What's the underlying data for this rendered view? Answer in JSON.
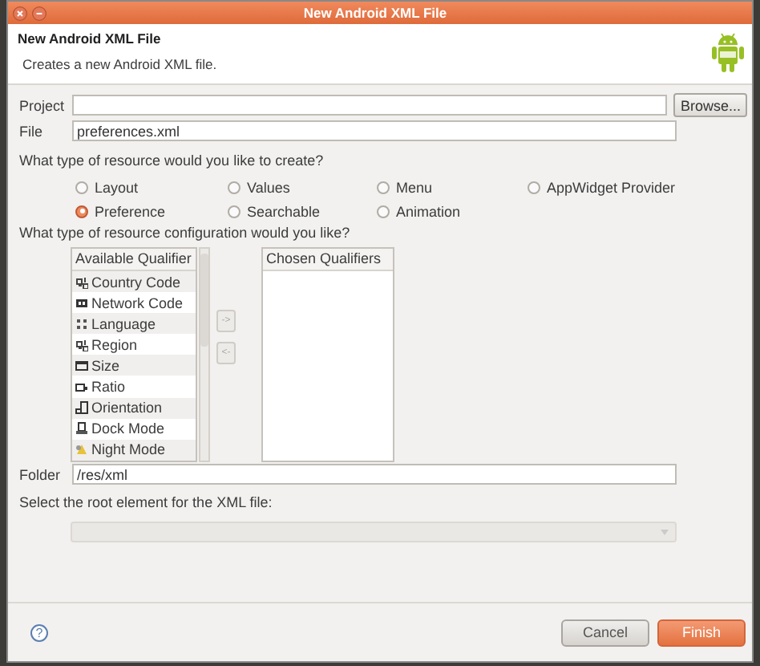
{
  "window": {
    "title": "New Android XML File"
  },
  "header": {
    "title": "New Android XML File",
    "description": "Creates a new Android XML file."
  },
  "project": {
    "label": "Project",
    "button": "Browse..."
  },
  "file": {
    "label": "File",
    "value": "preferences.xml"
  },
  "resource_type": {
    "question": "What type of resource would you like to create?",
    "options": [
      {
        "label": "Layout",
        "selected": false
      },
      {
        "label": "Values",
        "selected": false
      },
      {
        "label": "Menu",
        "selected": false
      },
      {
        "label": "AppWidget Provider",
        "selected": false
      },
      {
        "label": "Preference",
        "selected": true
      },
      {
        "label": "Searchable",
        "selected": false
      },
      {
        "label": "Animation",
        "selected": false
      }
    ]
  },
  "configuration": {
    "question": "What type of resource configuration would you like?",
    "available_header": "Available Qualifier",
    "chosen_header": "Chosen Qualifiers",
    "add_button": "->",
    "remove_button": "<-",
    "available": [
      "Country Code",
      "Network Code",
      "Language",
      "Region",
      "Size",
      "Ratio",
      "Orientation",
      "Dock Mode",
      "Night Mode"
    ]
  },
  "folder": {
    "label": "Folder",
    "value": "/res/xml"
  },
  "root_element": {
    "label": "Select the root element for the XML file:",
    "disabled": true
  },
  "buttons": {
    "help": "?",
    "cancel": "Cancel",
    "finish": "Finish"
  }
}
